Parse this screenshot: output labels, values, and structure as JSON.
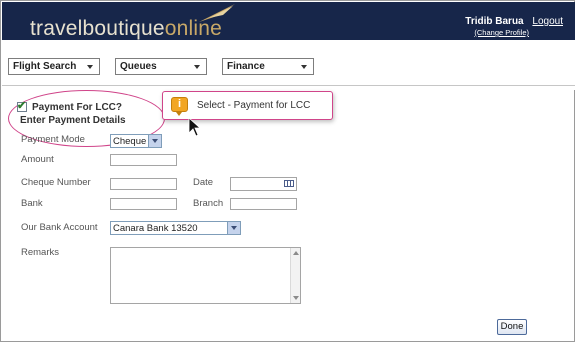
{
  "header": {
    "logo_part1": "travelboutique",
    "logo_part2": "online",
    "user_name": "Tridib Barua",
    "logout": "Logout",
    "change_profile": "(Change Profile)"
  },
  "nav": {
    "menus": [
      "Flight Search",
      "Queues",
      "Finance"
    ]
  },
  "payment": {
    "lcc_checkbox_label": "Payment For LCC?",
    "lcc_checked": true,
    "enter_details": "Enter Payment Details"
  },
  "tooltip": {
    "icon": "info-icon",
    "text": "Select - Payment for LCC"
  },
  "form": {
    "payment_mode_label": "Payment Mode",
    "payment_mode_value": "Cheque",
    "amount_label": "Amount",
    "cheque_number_label": "Cheque Number",
    "date_label": "Date",
    "bank_label": "Bank",
    "branch_label": "Branch",
    "our_bank_account_label": "Our Bank Account",
    "our_bank_account_value": "Canara Bank 13520",
    "remarks_label": "Remarks"
  },
  "done": "Done",
  "colors": {
    "header_bg": "#17264a",
    "logo_accent": "#c8a868",
    "highlight": "#d0458a",
    "info_icon": "#f2a623"
  }
}
